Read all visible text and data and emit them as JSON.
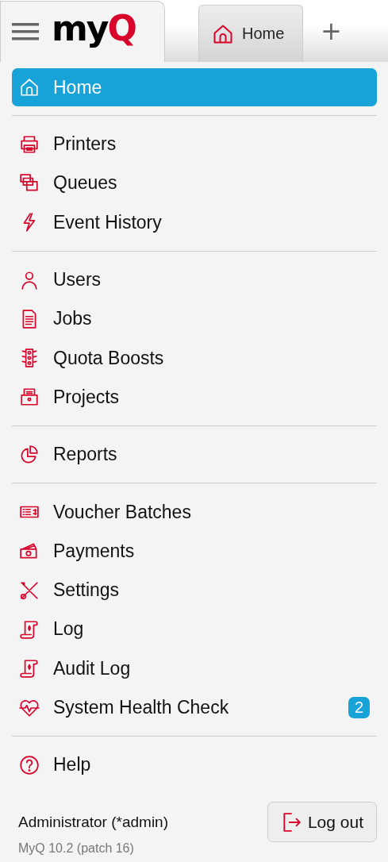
{
  "header": {
    "logo": {
      "dark": "my",
      "accent": "Q"
    },
    "tabs": [
      {
        "label": "Home",
        "selected": true
      }
    ],
    "new_tab": "+"
  },
  "menu": [
    [
      {
        "label": "Home",
        "selected": true
      }
    ],
    [
      {
        "label": "Printers",
        "selected": false
      },
      {
        "label": "Queues",
        "selected": false
      },
      {
        "label": "Event History",
        "selected": false
      }
    ],
    [
      {
        "label": "Users",
        "selected": false
      },
      {
        "label": "Jobs",
        "selected": false
      },
      {
        "label": "Quota Boosts",
        "selected": false
      },
      {
        "label": "Projects",
        "selected": false
      }
    ],
    [
      {
        "label": "Reports",
        "selected": false
      }
    ],
    [
      {
        "label": "Voucher Batches",
        "selected": false
      },
      {
        "label": "Payments",
        "selected": false
      },
      {
        "label": "Settings",
        "selected": false
      },
      {
        "label": "Log",
        "selected": false
      },
      {
        "label": "Audit Log",
        "selected": false
      },
      {
        "label": "System Health Check",
        "selected": false,
        "badge": "2"
      }
    ],
    [
      {
        "label": "Help",
        "selected": false
      }
    ]
  ],
  "footer": {
    "user": "Administrator (*admin)",
    "version": "MyQ 10.2 (patch 16)",
    "logout": "Log out"
  }
}
